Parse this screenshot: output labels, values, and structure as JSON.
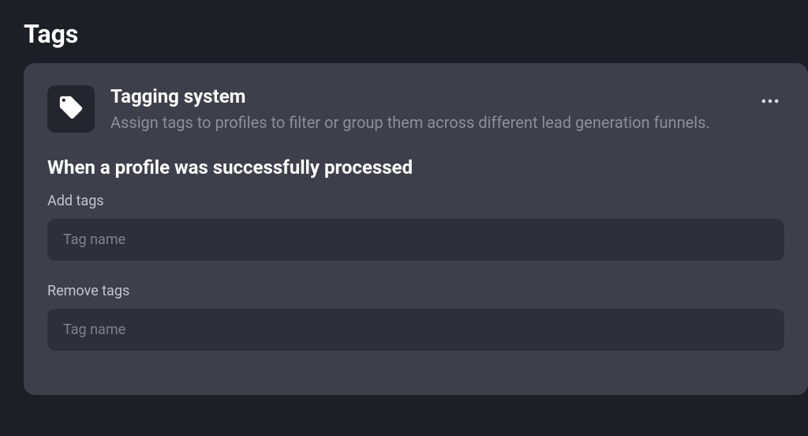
{
  "page": {
    "title": "Tags"
  },
  "card": {
    "title": "Tagging system",
    "description": "Assign tags to profiles to filter or group them across different lead generation funnels."
  },
  "section": {
    "title": "When a profile was successfully processed"
  },
  "fields": {
    "addTags": {
      "label": "Add tags",
      "placeholder": "Tag name",
      "value": ""
    },
    "removeTags": {
      "label": "Remove tags",
      "placeholder": "Tag name",
      "value": ""
    }
  }
}
